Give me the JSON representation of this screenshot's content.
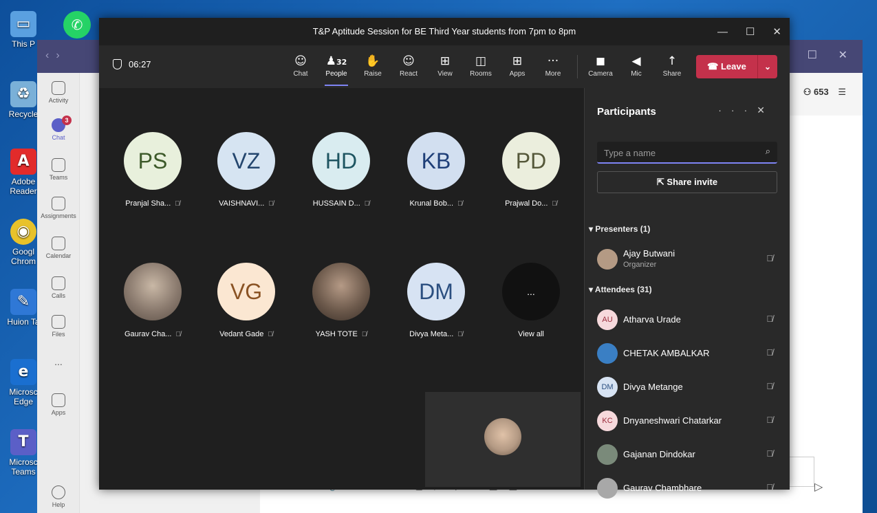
{
  "desktop": {
    "icons": [
      "This P",
      "Recycle",
      "Adobe Reader",
      "Googl Chrom",
      "Huion Ta",
      "Microsc Edge",
      "Microsc Teams"
    ]
  },
  "background_teams": {
    "rail": [
      "Activity",
      "Chat",
      "Teams",
      "Assignments",
      "Calendar",
      "Calls",
      "Files",
      "...",
      "Apps",
      "Help"
    ],
    "chat_badge": "3",
    "participant_count": "653",
    "compose_icons": [
      "✎",
      "📎",
      "☺",
      "☺",
      "GIF",
      "▢",
      "▷",
      "♀",
      "↻",
      "▣",
      "▤",
      "···"
    ]
  },
  "meeting": {
    "title": "T&P Aptitude Session for BE Third Year students from 7pm to 8pm",
    "window_buttons": [
      "—",
      "☐",
      "✕"
    ],
    "timer": "06:27",
    "toolbar": [
      {
        "label": "Chat",
        "icon": "☺"
      },
      {
        "label": "People",
        "icon": "♟",
        "count": "32"
      },
      {
        "label": "Raise",
        "icon": "✋"
      },
      {
        "label": "React",
        "icon": "☺"
      },
      {
        "label": "View",
        "icon": "⊞"
      },
      {
        "label": "Rooms",
        "icon": "◫"
      },
      {
        "label": "Apps",
        "icon": "⊞"
      },
      {
        "label": "More",
        "icon": "···"
      },
      {
        "label": "Camera",
        "icon": "◼"
      },
      {
        "label": "Mic",
        "icon": "◀"
      },
      {
        "label": "Share",
        "icon": "↑"
      }
    ],
    "leave_label": "Leave",
    "tiles": [
      {
        "initials": "PS",
        "name": "Pranjal Sha...",
        "bg": "#e8f0dc",
        "fg": "#3d5a2a"
      },
      {
        "initials": "VZ",
        "name": "VAISHNAVI...",
        "bg": "#d6e4f2",
        "fg": "#24466e"
      },
      {
        "initials": "HD",
        "name": "HUSSAIN D...",
        "bg": "#d9ecf0",
        "fg": "#1e5561"
      },
      {
        "initials": "KB",
        "name": "Krunal Bob...",
        "bg": "#d2dff0",
        "fg": "#1f3f78"
      },
      {
        "initials": "PD",
        "name": "Prajwal Do...",
        "bg": "#ebeedd",
        "fg": "#55583a"
      },
      {
        "initials": "",
        "name": "Gaurav Cha...",
        "bg": "#8a7a6e",
        "fg": "#fff"
      },
      {
        "initials": "VG",
        "name": "Vedant Gade",
        "bg": "#fbe7d2",
        "fg": "#8a5324"
      },
      {
        "initials": "",
        "name": "YASH TOTE",
        "bg": "#6d5a4c",
        "fg": "#fff"
      },
      {
        "initials": "DM",
        "name": "Divya Meta...",
        "bg": "#d7e3f3",
        "fg": "#2b4f80"
      },
      {
        "initials": "...",
        "name": "View all",
        "bg": "#111111",
        "fg": "#fff"
      }
    ]
  },
  "participants": {
    "title": "Participants",
    "search_placeholder": "Type a name",
    "share_invite": "Share invite",
    "presenters_header": "Presenters (1)",
    "attendees_header": "Attendees (31)",
    "presenters": [
      {
        "name": "Ajay Butwani",
        "role": "Organizer",
        "initials": "",
        "bg": "#b49a84"
      }
    ],
    "attendees": [
      {
        "name": "Atharva Urade",
        "initials": "AU",
        "bg": "#f6d9dc",
        "fg": "#9a2a3a"
      },
      {
        "name": "CHETAK AMBALKAR",
        "initials": "",
        "bg": "#3a7fc4",
        "fg": "#fff"
      },
      {
        "name": "Divya Metange",
        "initials": "DM",
        "bg": "#d7e3f3",
        "fg": "#2b4f80"
      },
      {
        "name": "Dnyaneshwari Chatarkar",
        "initials": "KC",
        "bg": "#f6d9dc",
        "fg": "#9a2a3a"
      },
      {
        "name": "Gajanan Dindokar",
        "initials": "",
        "bg": "#7a8a7a",
        "fg": "#fff"
      },
      {
        "name": "Gaurav Chambhare",
        "initials": "",
        "bg": "#a8a8a8",
        "fg": "#fff"
      }
    ]
  }
}
